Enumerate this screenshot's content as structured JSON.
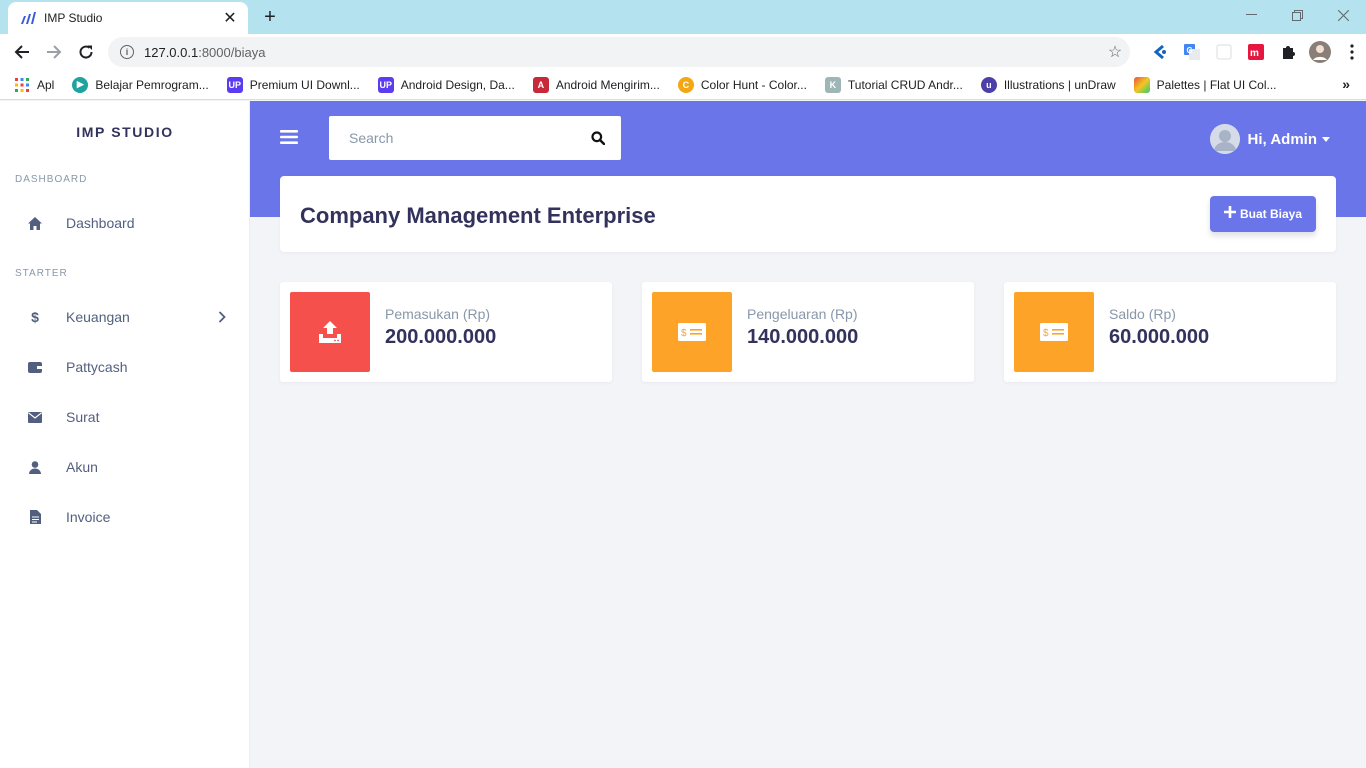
{
  "browser": {
    "tab_title": "IMP Studio",
    "url_host": "127.0.0.1",
    "url_rest": ":8000/biaya",
    "bookmarks": [
      {
        "label": "Apl",
        "color": "#ffffff"
      },
      {
        "label": "Belajar Pemrogram...",
        "color": "#20a39e"
      },
      {
        "label": "Premium UI Downl...",
        "color": "#5b3cf0"
      },
      {
        "label": "Android Design, Da...",
        "color": "#5b3cf0"
      },
      {
        "label": "Android Mengirim...",
        "color": "#c62a3a"
      },
      {
        "label": "Color Hunt - Color...",
        "color": "#f3a712"
      },
      {
        "label": "Tutorial CRUD Andr...",
        "color": "#9fb6b8"
      },
      {
        "label": "Illustrations | unDraw",
        "color": "#4d3fa8"
      },
      {
        "label": "Palettes | Flat UI Col...",
        "color": "#e8533a"
      }
    ]
  },
  "sidebar": {
    "brand": "IMP STUDIO",
    "section_dashboard": "DASHBOARD",
    "section_starter": "STARTER",
    "items": [
      {
        "label": "Dashboard",
        "icon": "home-icon"
      },
      {
        "label": "Keuangan",
        "icon": "dollar-icon"
      },
      {
        "label": "Pattycash",
        "icon": "wallet-icon"
      },
      {
        "label": "Surat",
        "icon": "envelope-icon"
      },
      {
        "label": "Akun",
        "icon": "user-icon"
      },
      {
        "label": "Invoice",
        "icon": "file-icon"
      }
    ]
  },
  "topbar": {
    "search_placeholder": "Search",
    "user_greeting": "Hi, Admin"
  },
  "main": {
    "title": "Company Management Enterprise",
    "create_button": "Buat Biaya",
    "stats": [
      {
        "label": "Pemasukan (Rp)",
        "value": "200.000.000",
        "color": "#f5504c",
        "icon": "upload-icon"
      },
      {
        "label": "Pengeluaran (Rp)",
        "value": "140.000.000",
        "color": "#fca328",
        "icon": "money-icon"
      },
      {
        "label": "Saldo (Rp)",
        "value": "60.000.000",
        "color": "#fca328",
        "icon": "money-icon"
      }
    ]
  },
  "colors": {
    "accent": "#6a75e9",
    "income": "#f5504c",
    "expense": "#fca328"
  }
}
